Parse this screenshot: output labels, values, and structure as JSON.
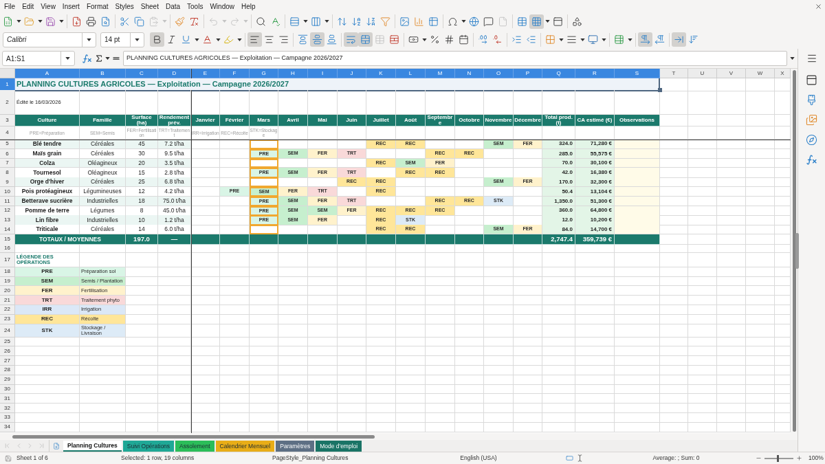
{
  "menu": [
    "File",
    "Edit",
    "View",
    "Insert",
    "Format",
    "Styles",
    "Sheet",
    "Data",
    "Tools",
    "Window",
    "Help"
  ],
  "standard_toolbar": {
    "paste_disabled": true,
    "undo_disabled": true,
    "redo_disabled": true,
    "headers_footers_disabled": true,
    "freeze_active": true
  },
  "formatting_toolbar": {
    "font_name": "Calibri",
    "font_size": "14 pt",
    "bold": true,
    "italic": false,
    "underline": false,
    "align_left": true,
    "align_center": false,
    "align_right": false,
    "align_top": false,
    "align_middle": true,
    "align_bottom": false,
    "wrap_text": true,
    "merge_center": true,
    "merge_cells_disabled": true,
    "left_to_right": true,
    "right_to_left": false,
    "text_horizontal": true,
    "text_vertical": false
  },
  "formula_bar": {
    "name_box": "A1:S1",
    "content": "PLANNING CULTURES AGRICOLES — Exploitation — Campagne 2026/2027"
  },
  "columns": [
    {
      "label": "A",
      "selected": true
    },
    {
      "label": "B",
      "selected": true
    },
    {
      "label": "C",
      "selected": true
    },
    {
      "label": "D",
      "selected": true
    },
    {
      "label": "E",
      "selected": true
    },
    {
      "label": "F",
      "selected": true
    },
    {
      "label": "G",
      "selected": true
    },
    {
      "label": "H",
      "selected": true
    },
    {
      "label": "I",
      "selected": true
    },
    {
      "label": "J",
      "selected": true
    },
    {
      "label": "K",
      "selected": true
    },
    {
      "label": "L",
      "selected": true
    },
    {
      "label": "M",
      "selected": true
    },
    {
      "label": "N",
      "selected": true
    },
    {
      "label": "O",
      "selected": true
    },
    {
      "label": "P",
      "selected": true
    },
    {
      "label": "Q",
      "selected": true
    },
    {
      "label": "R",
      "selected": true
    },
    {
      "label": "S",
      "selected": true
    },
    {
      "label": "T",
      "selected": false
    },
    {
      "label": "U",
      "selected": false
    },
    {
      "label": "V",
      "selected": false
    },
    {
      "label": "W",
      "selected": false
    },
    {
      "label": "X",
      "selected": false
    }
  ],
  "row_headers": [
    {
      "label": "1",
      "selected": true
    },
    {
      "label": "2",
      "selected": false
    },
    {
      "label": "3",
      "selected": false
    },
    {
      "label": "4",
      "selected": false
    },
    {
      "label": "5",
      "selected": false
    },
    {
      "label": "6",
      "selected": false
    },
    {
      "label": "7",
      "selected": false
    },
    {
      "label": "8",
      "selected": false
    },
    {
      "label": "9",
      "selected": false
    },
    {
      "label": "10",
      "selected": false
    },
    {
      "label": "11",
      "selected": false
    },
    {
      "label": "12",
      "selected": false
    },
    {
      "label": "13",
      "selected": false
    },
    {
      "label": "14",
      "selected": false
    },
    {
      "label": "15",
      "selected": false
    },
    {
      "label": "16",
      "selected": false
    },
    {
      "label": "17",
      "selected": false
    },
    {
      "label": "18",
      "selected": false
    },
    {
      "label": "19",
      "selected": false
    },
    {
      "label": "20",
      "selected": false
    },
    {
      "label": "21",
      "selected": false
    },
    {
      "label": "22",
      "selected": false
    },
    {
      "label": "23",
      "selected": false
    },
    {
      "label": "24",
      "selected": false
    },
    {
      "label": "25",
      "selected": false
    },
    {
      "label": "26",
      "selected": false
    },
    {
      "label": "27",
      "selected": false
    },
    {
      "label": "28",
      "selected": false
    },
    {
      "label": "29",
      "selected": false
    },
    {
      "label": "30",
      "selected": false
    },
    {
      "label": "31",
      "selected": false
    },
    {
      "label": "32",
      "selected": false
    },
    {
      "label": "33",
      "selected": false
    },
    {
      "label": "34",
      "selected": false
    }
  ],
  "sheet": {
    "title": "PLANNING CULTURES AGRICOLES — Exploitation — Campagne 2026/2027",
    "edited": "Édité le 16/03/2026",
    "header": {
      "lead": [
        "Culture",
        "Famille",
        "Surface (ha)",
        "Rendement prév."
      ],
      "months": [
        {
          "label": "Janvier",
          "current": false
        },
        {
          "label": "Février",
          "current": false
        },
        {
          "label": "Mars",
          "current": true
        },
        {
          "label": "Avril",
          "current": false
        },
        {
          "label": "Mai",
          "current": false
        },
        {
          "label": "Juin",
          "current": false
        },
        {
          "label": "Juillet",
          "current": false
        },
        {
          "label": "Août",
          "current": false
        },
        {
          "label": "Septembre",
          "current": false
        },
        {
          "label": "Octobre",
          "current": false
        },
        {
          "label": "Novembre",
          "current": false
        },
        {
          "label": "Décembre",
          "current": false
        }
      ],
      "tail": [
        "Total prod. (t)",
        "CA estimé (€)",
        "Observations"
      ]
    },
    "hints": [
      "PRE=Préparation",
      "SEM=Semis",
      "FER=Fertilisation",
      "TRT=Traitement",
      "IRR=Irrigation",
      "REC=Récolte",
      "STK=Stockage"
    ],
    "rows": [
      {
        "culture": "Blé tendre",
        "family": "Céréales",
        "surface": "45",
        "yield": "7.2 t/ha",
        "ops": {
          "jul": {
            "code": "REC",
            "color": "#ffe699"
          },
          "aug": {
            "code": "REC",
            "color": "#ffe699"
          },
          "nov": {
            "code": "SEM",
            "color": "#c6efce"
          },
          "dec": {
            "code": "FER",
            "color": "#fff2cc"
          }
        },
        "production": "324.0",
        "revenue": "71,280 €"
      },
      {
        "culture": "Maïs grain",
        "family": "Céréales",
        "surface": "30",
        "yield": "9.5 t/ha",
        "ops": {
          "mar": {
            "code": "PRE",
            "color": "#d9f5e6"
          },
          "apr": {
            "code": "SEM",
            "color": "#c6efce"
          },
          "may": {
            "code": "FER",
            "color": "#fff2cc"
          },
          "jun": {
            "code": "TRT",
            "color": "#f9d9d9"
          },
          "sep": {
            "code": "REC",
            "color": "#ffe699"
          },
          "oct": {
            "code": "REC",
            "color": "#ffe699"
          }
        },
        "production": "285.0",
        "revenue": "55,575 €"
      },
      {
        "culture": "Colza",
        "family": "Oléagineux",
        "surface": "20",
        "yield": "3.5 t/ha",
        "ops": {
          "jul": {
            "code": "REC",
            "color": "#ffe699"
          },
          "aug": {
            "code": "SEM",
            "color": "#c6efce"
          },
          "sep": {
            "code": "FER",
            "color": "#fff2cc"
          }
        },
        "production": "70.0",
        "revenue": "30,100 €"
      },
      {
        "culture": "Tournesol",
        "family": "Oléagineux",
        "surface": "15",
        "yield": "2.8 t/ha",
        "ops": {
          "mar": {
            "code": "PRE",
            "color": "#d9f5e6"
          },
          "apr": {
            "code": "SEM",
            "color": "#c6efce"
          },
          "may": {
            "code": "FER",
            "color": "#fff2cc"
          },
          "jun": {
            "code": "TRT",
            "color": "#f9d9d9"
          },
          "aug": {
            "code": "REC",
            "color": "#ffe699"
          },
          "sep": {
            "code": "REC",
            "color": "#ffe699"
          }
        },
        "production": "42.0",
        "revenue": "16,380 €"
      },
      {
        "culture": "Orge d'hiver",
        "family": "Céréales",
        "surface": "25",
        "yield": "6.8 t/ha",
        "ops": {
          "jun": {
            "code": "REC",
            "color": "#ffe699"
          },
          "jul": {
            "code": "REC",
            "color": "#ffe699"
          },
          "nov": {
            "code": "SEM",
            "color": "#c6efce"
          },
          "dec": {
            "code": "FER",
            "color": "#fff2cc"
          }
        },
        "production": "170.0",
        "revenue": "32,300 €"
      },
      {
        "culture": "Pois protéagineux",
        "family": "Légumineuses",
        "surface": "12",
        "yield": "4.2 t/ha",
        "ops": {
          "feb": {
            "code": "PRE",
            "color": "#d9f5e6"
          },
          "mar": {
            "code": "SEM",
            "color": "#c6efce"
          },
          "apr": {
            "code": "FER",
            "color": "#fff2cc"
          },
          "may": {
            "code": "TRT",
            "color": "#f9d9d9"
          },
          "jul": {
            "code": "REC",
            "color": "#ffe699"
          }
        },
        "production": "50.4",
        "revenue": "13,104 €"
      },
      {
        "culture": "Betterave sucrière",
        "family": "Industrielles",
        "surface": "18",
        "yield": "75.0 t/ha",
        "ops": {
          "mar": {
            "code": "PRE",
            "color": "#d9f5e6"
          },
          "apr": {
            "code": "SEM",
            "color": "#c6efce"
          },
          "may": {
            "code": "FER",
            "color": "#fff2cc"
          },
          "jun": {
            "code": "TRT",
            "color": "#f9d9d9"
          },
          "sep": {
            "code": "REC",
            "color": "#ffe699"
          },
          "oct": {
            "code": "REC",
            "color": "#ffe699"
          },
          "nov": {
            "code": "STK",
            "color": "#ddebf7"
          }
        },
        "production": "1,350.0",
        "revenue": "51,300 €"
      },
      {
        "culture": "Pomme de terre",
        "family": "Légumes",
        "surface": "8",
        "yield": "45.0 t/ha",
        "ops": {
          "mar": {
            "code": "PRE",
            "color": "#d9f5e6"
          },
          "apr": {
            "code": "SEM",
            "color": "#c6efce"
          },
          "may": {
            "code": "SEM",
            "color": "#c6efce"
          },
          "jun": {
            "code": "FER",
            "color": "#fff2cc"
          },
          "jul": {
            "code": "REC",
            "color": "#ffe699"
          },
          "aug": {
            "code": "REC",
            "color": "#ffe699"
          },
          "sep": {
            "code": "REC",
            "color": "#ffe699"
          }
        },
        "production": "360.0",
        "revenue": "64,800 €"
      },
      {
        "culture": "Lin fibre",
        "family": "Industrielles",
        "surface": "10",
        "yield": "1.2 t/ha",
        "ops": {
          "mar": {
            "code": "PRE",
            "color": "#d9f5e6"
          },
          "apr": {
            "code": "SEM",
            "color": "#c6efce"
          },
          "may": {
            "code": "FER",
            "color": "#fff2cc"
          },
          "jul": {
            "code": "REC",
            "color": "#ffe699"
          },
          "aug": {
            "code": "STK",
            "color": "#ddebf7"
          }
        },
        "production": "12.0",
        "revenue": "10,200 €"
      },
      {
        "culture": "Triticale",
        "family": "Céréales",
        "surface": "14",
        "yield": "6.0 t/ha",
        "ops": {
          "jul": {
            "code": "REC",
            "color": "#ffe699"
          },
          "aug": {
            "code": "REC",
            "color": "#ffe699"
          },
          "nov": {
            "code": "SEM",
            "color": "#c6efce"
          },
          "dec": {
            "code": "FER",
            "color": "#fff2cc"
          }
        },
        "production": "84.0",
        "revenue": "14,700 €"
      }
    ],
    "totals": {
      "label": "TOTAUX / MOYENNES",
      "surface": "197.0",
      "yield": "—",
      "production": "2,747.4",
      "revenue": "359,739 €"
    },
    "legend": {
      "title": "LÉGENDE DES OPÉRATIONS",
      "items": [
        {
          "code": "PRE",
          "label": "Préparation sol",
          "color": "#d9f5e6"
        },
        {
          "code": "SEM",
          "label": "Semis / Plantation",
          "color": "#c6efce"
        },
        {
          "code": "FER",
          "label": "Fertilisation",
          "color": "#fff2cc"
        },
        {
          "code": "TRT",
          "label": "Traitement phyto",
          "color": "#f9d9d9"
        },
        {
          "code": "IRR",
          "label": "Irrigation",
          "color": "#dbe8f7"
        },
        {
          "code": "REC",
          "label": "Récolte",
          "color": "#ffe699"
        },
        {
          "code": "STK",
          "label": "Stockage / Livraison",
          "color": "#ddebf7"
        }
      ]
    }
  },
  "sheet_tabs": [
    {
      "label": "Planning Cultures",
      "selected": true,
      "color": "#1b7a6c"
    },
    {
      "label": "Suivi Opérations",
      "selected": false,
      "color": "#1fa896"
    },
    {
      "label": "Assolement",
      "selected": false,
      "color": "#2bbd59"
    },
    {
      "label": "Calendrier Mensuel",
      "selected": false,
      "color": "#e8ad17"
    },
    {
      "label": "Paramètres",
      "selected": false,
      "color": "#5d6f84"
    },
    {
      "label": "Mode d'emploi",
      "selected": false,
      "color": "#1a7466"
    }
  ],
  "status_bar": {
    "sheet": "Sheet 1 of 6",
    "selection": "Selected: 1 row, 19 columns",
    "page_style": "PageStyle_Planning Cultures",
    "language": "English (USA)",
    "summary": "Average: ; Sum: 0",
    "zoom_slider": {
      "level": 0.47
    },
    "zoom": "100%"
  }
}
